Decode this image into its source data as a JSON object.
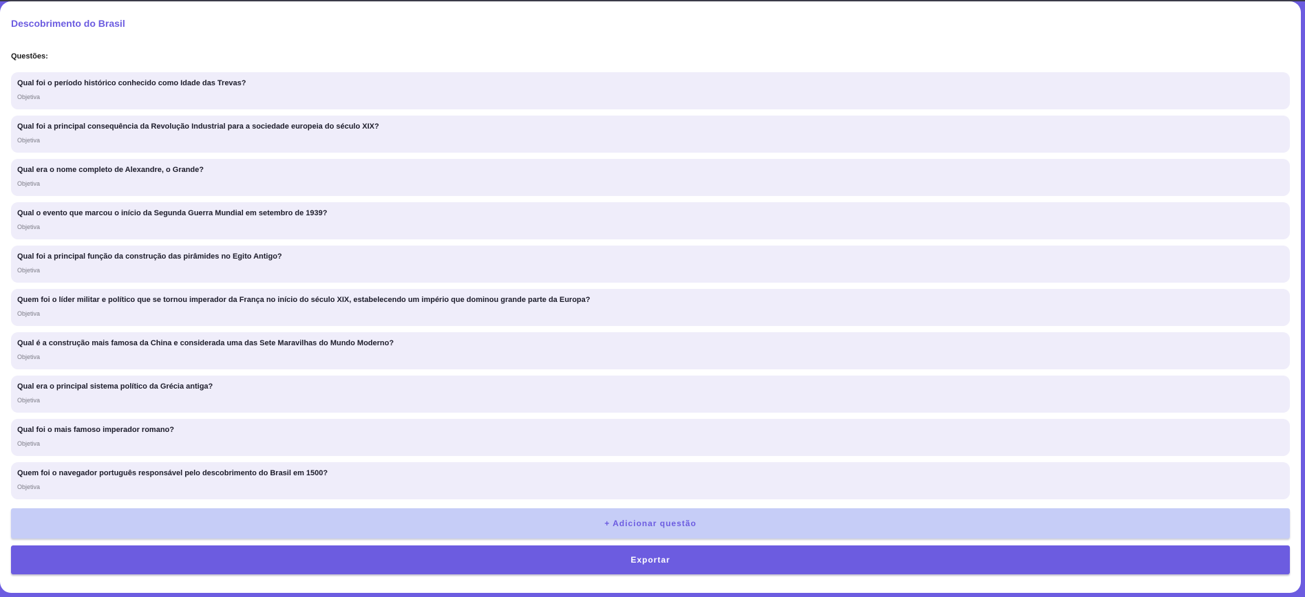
{
  "colors": {
    "accent": "#6c5ce0",
    "question_bg": "#efedfa",
    "add_button_bg": "#c6cdf7",
    "page_bg": "#ffffff"
  },
  "quiz": {
    "title": "Descobrimento do Brasil",
    "questions_label": "Questões:",
    "questions": [
      {
        "text": "Qual foi o período histórico conhecido como Idade das Trevas?",
        "type": "Objetiva"
      },
      {
        "text": "Qual foi a principal consequência da Revolução Industrial para a sociedade europeia do século XIX?",
        "type": "Objetiva"
      },
      {
        "text": "Qual era o nome completo de Alexandre, o Grande?",
        "type": "Objetiva"
      },
      {
        "text": "Qual o evento que marcou o início da Segunda Guerra Mundial em setembro de 1939?",
        "type": "Objetiva"
      },
      {
        "text": "Qual foi a principal função da construção das pirâmides no Egito Antigo?",
        "type": "Objetiva"
      },
      {
        "text": "Quem foi o líder militar e político que se tornou imperador da França no início do século XIX, estabelecendo um império que dominou grande parte da Europa?",
        "type": "Objetiva"
      },
      {
        "text": "Qual é a construção mais famosa da China e considerada uma das Sete Maravilhas do Mundo Moderno?",
        "type": "Objetiva"
      },
      {
        "text": "Qual era o principal sistema político da Grécia antiga?",
        "type": "Objetiva"
      },
      {
        "text": "Qual foi o mais famoso imperador romano?",
        "type": "Objetiva"
      },
      {
        "text": "Quem foi o navegador português responsável pelo descobrimento do Brasil em 1500?",
        "type": "Objetiva"
      }
    ],
    "add_question_label": "+ Adicionar questão",
    "export_label": "Exportar"
  }
}
